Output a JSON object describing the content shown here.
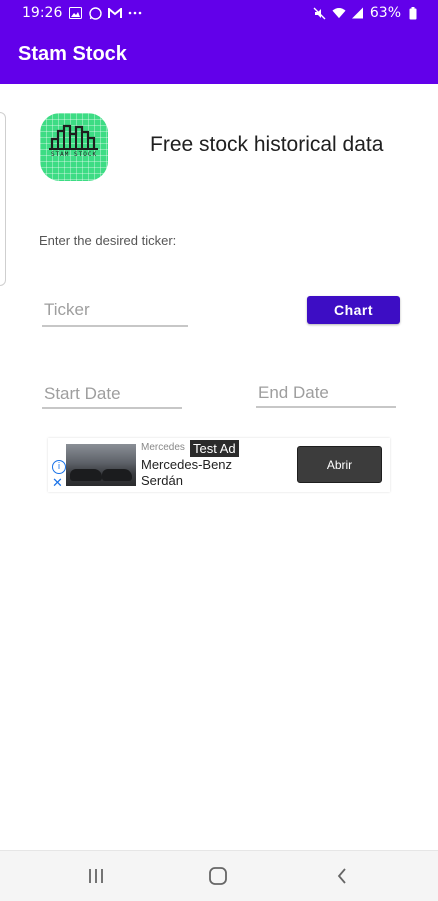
{
  "status_bar": {
    "time": "19:26",
    "battery": "63%",
    "icons": [
      "image-icon",
      "whatsapp-icon",
      "gmail-icon",
      "more-icon",
      "mute-icon",
      "wifi-icon",
      "signal-icon",
      "battery-icon"
    ]
  },
  "app_bar": {
    "title": "Stam Stock"
  },
  "logo": {
    "text": "STAM STOCK",
    "color": "#3ddc84"
  },
  "header": {
    "headline": "Free stock historical data"
  },
  "form": {
    "prompt": "Enter the desired ticker:",
    "ticker_placeholder": "Ticker",
    "chart_button": "Chart",
    "start_date_placeholder": "Start Date",
    "end_date_placeholder": "End Date"
  },
  "ad": {
    "brand": "Mercedes",
    "badge": "Test Ad",
    "title": "Mercedes-Benz",
    "subtitle": "Serdán",
    "button": "Abrir"
  },
  "colors": {
    "primary": "#6200EA",
    "button": "#3D0DC4"
  }
}
